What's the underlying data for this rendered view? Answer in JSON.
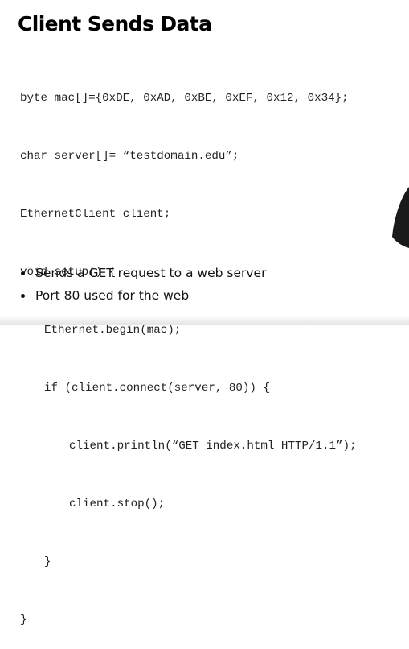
{
  "slide": {
    "title": "Client Sends Data",
    "code_lines": [
      "byte mac[]={0xDE, 0xAD, 0xBE, 0xEF, 0x12, 0x34};",
      "char server[]= “testdomain.edu”;",
      "EthernetClient client;",
      "void setup() {",
      "Ethernet.begin(mac);",
      "if (client.connect(server, 80)) {",
      "client.println(“GET index.html HTTP/1.1”);",
      "client.stop();",
      "}",
      "}"
    ],
    "bullets": [
      "Sends a GET request to a web server",
      "Port 80 used for the web"
    ]
  },
  "colors": {
    "background": "#ffffff",
    "text": "#000000",
    "presenter_silhouette": "#1a1a1a"
  }
}
